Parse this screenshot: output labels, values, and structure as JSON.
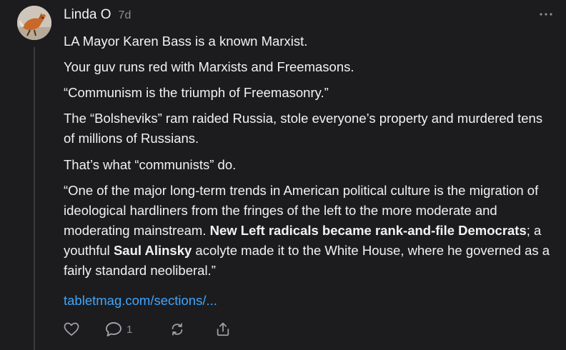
{
  "post": {
    "author": "Linda O",
    "time": "7d",
    "avatar_icon": "fox-avatar",
    "paragraphs": [
      "LA Mayor Karen Bass is a known Marxist.",
      "Your guv runs red with Marxists and Freemasons.",
      "“Communism is the triumph of Freemasonry.”",
      "The “Bolsheviks” ram raided Russia, stole everyone’s property and murdered tens of millions of Russians.",
      "That’s what “communists” do."
    ],
    "quote": {
      "part1": "“One of the major long-term trends in American political culture is the migration of ideological hardliners from the fringes of the left to the more moderate and moderating mainstream. ",
      "bold1": "New Left radicals became rank-and-file Democrats",
      "part2": "; a youthful ",
      "bold2": "Saul Alinsky",
      "part3": " acolyte made it to the White House, where he governed as a fairly standard neoliberal.”"
    },
    "link_text": "tabletmag.com/sections/...",
    "link_color": "#3ea6ff"
  },
  "actions": {
    "like_icon": "heart-icon",
    "reply_icon": "comment-icon",
    "reply_count": "1",
    "repost_icon": "repost-icon",
    "share_icon": "share-icon"
  },
  "menu": {
    "icon": "more-icon"
  }
}
